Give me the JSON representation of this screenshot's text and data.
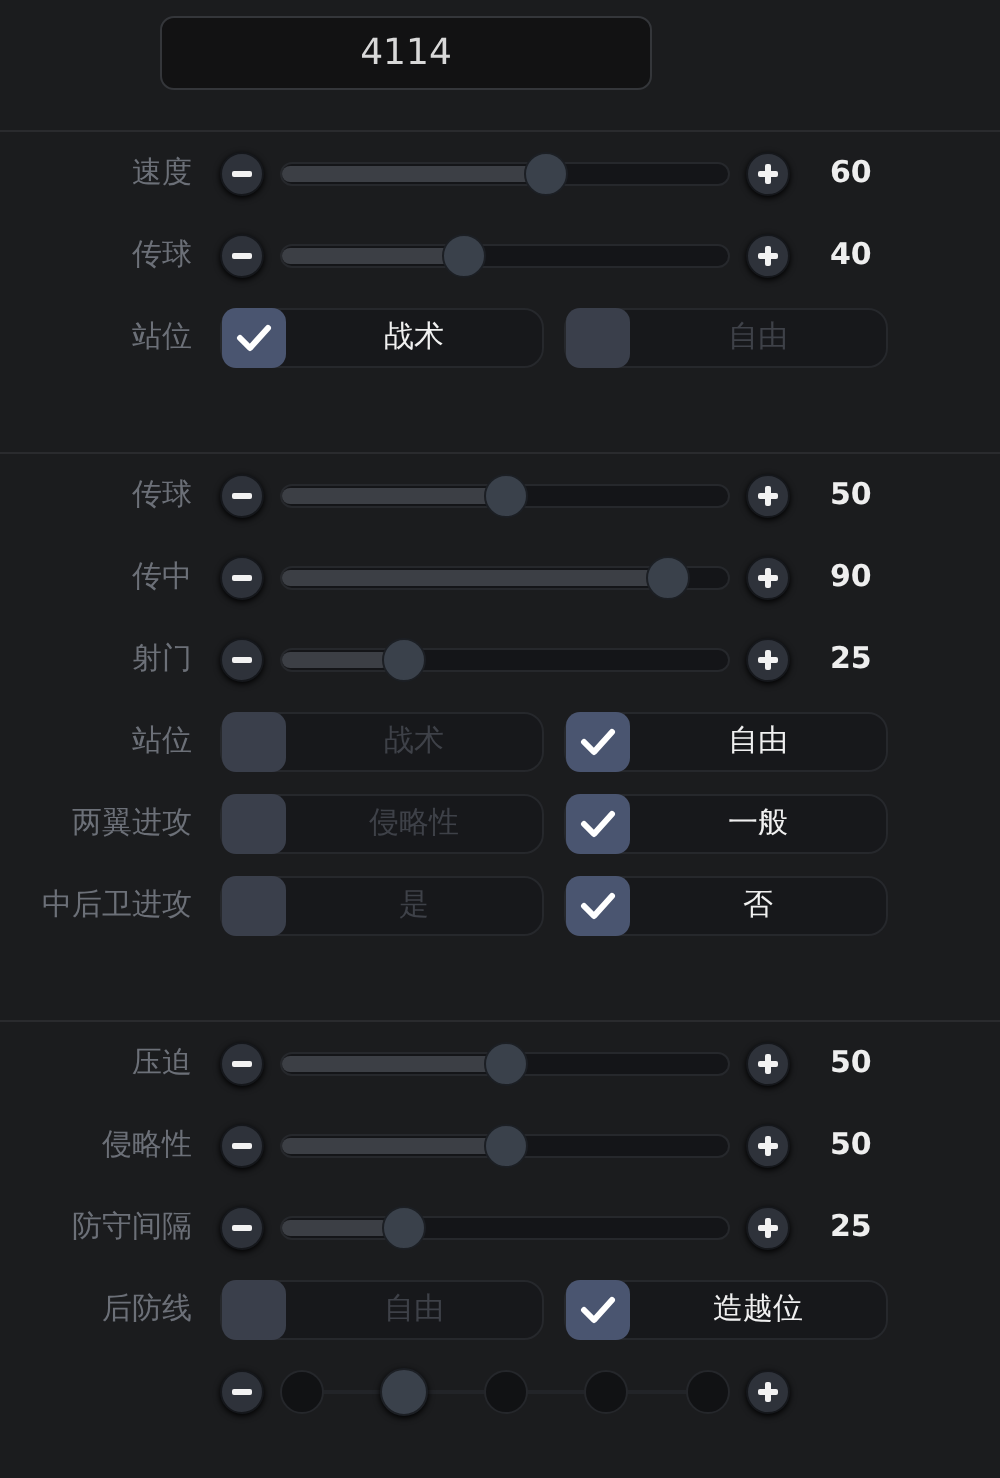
{
  "formation": {
    "value": "4114"
  },
  "sections": [
    {
      "rows": [
        {
          "kind": "slider",
          "label": "速度",
          "level": 0.6,
          "reading": "60"
        },
        {
          "kind": "slider",
          "label": "传球",
          "level": 0.4,
          "reading": "40"
        },
        {
          "kind": "choice",
          "label": "站位",
          "options": [
            {
              "label": "战术",
              "selected": true
            },
            {
              "label": "自由",
              "selected": false
            }
          ]
        }
      ]
    },
    {
      "rows": [
        {
          "kind": "slider",
          "label": "传球",
          "level": 0.5,
          "reading": "50"
        },
        {
          "kind": "slider",
          "label": "传中",
          "level": 0.9,
          "reading": "90"
        },
        {
          "kind": "slider",
          "label": "射门",
          "level": 0.25,
          "reading": "25"
        },
        {
          "kind": "choice",
          "label": "站位",
          "options": [
            {
              "label": "战术",
              "selected": false
            },
            {
              "label": "自由",
              "selected": true
            }
          ]
        },
        {
          "kind": "choice",
          "label": "两翼进攻",
          "options": [
            {
              "label": "侵略性",
              "selected": false
            },
            {
              "label": "一般",
              "selected": true
            }
          ]
        },
        {
          "kind": "choice",
          "label": "中后卫进攻",
          "options": [
            {
              "label": "是",
              "selected": false
            },
            {
              "label": "否",
              "selected": true
            }
          ]
        }
      ]
    },
    {
      "rows": [
        {
          "kind": "slider",
          "label": "压迫",
          "level": 0.5,
          "reading": "50"
        },
        {
          "kind": "slider",
          "label": "侵略性",
          "level": 0.5,
          "reading": "50"
        },
        {
          "kind": "slider",
          "label": "防守间隔",
          "level": 0.25,
          "reading": "25"
        },
        {
          "kind": "choice",
          "label": "后防线",
          "options": [
            {
              "label": "自由",
              "selected": false
            },
            {
              "label": "造越位",
              "selected": true
            }
          ]
        },
        {
          "kind": "stepper",
          "level": 0.25
        }
      ]
    }
  ]
}
